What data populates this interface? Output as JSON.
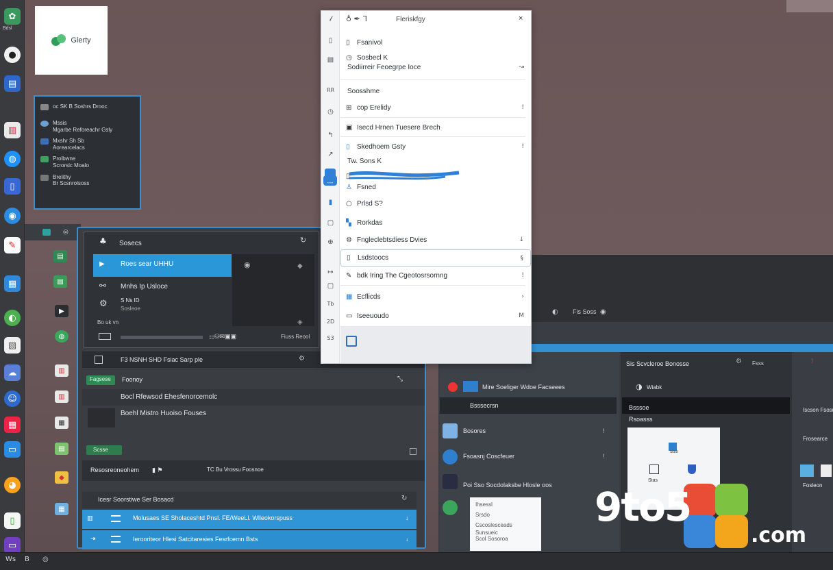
{
  "colors": {
    "accent": "#2f95d6",
    "menu_bg": "#ffffff",
    "dark_window": "#3a3d42"
  },
  "glerty": {
    "name": "Glerty"
  },
  "mini_panel": {
    "title": "oc SK B Soshrs Drooc",
    "rows": [
      {
        "icon": "user-icon",
        "line1": "Mssis",
        "line2": "Mgarbe Reforeachr Gsly"
      },
      {
        "icon": "book-icon",
        "line1": "Mxshr Sh Sb",
        "line2": "Aorearcelacs"
      },
      {
        "icon": "leaf-icon",
        "line1": "Prolbwne",
        "line2": "Scrorsic Moalo"
      },
      {
        "icon": "folder-icon",
        "line1": "Brelithy",
        "line2": "Br Scsnrolsoss"
      }
    ]
  },
  "context_menu": {
    "header": {
      "title": "Fleriskfgy",
      "close": "×"
    },
    "items": [
      {
        "icon": "doc-icon",
        "label": "Fsanivol",
        "right": ""
      },
      {
        "icon": "clock-icon",
        "label": "Sosbecl K",
        "right": ""
      },
      {
        "icon": "",
        "label": "Sodiirreir Feoegrpe Ioce",
        "right": "↝"
      },
      {
        "icon": "",
        "label": "Soosshme",
        "right": ""
      },
      {
        "icon": "grid-icon",
        "label": "cop Erelidy",
        "right": "!"
      },
      {
        "icon": "image-icon",
        "label": "Isecd Hrnen Tuesere Brech",
        "right": ""
      },
      {
        "icon": "file-icon",
        "label": "Skedhoem Gsty",
        "right": "!"
      },
      {
        "icon": "",
        "label": "Tw. Sons K",
        "right": ""
      },
      {
        "icon": "doc-icon",
        "label": "",
        "right": ""
      },
      {
        "icon": "person-icon",
        "label": "Fsned",
        "right": ""
      },
      {
        "icon": "circle-icon",
        "label": "Prlsd S?",
        "right": ""
      },
      {
        "icon": "chart-icon",
        "label": "Rorkdas",
        "right": ""
      },
      {
        "icon": "gear-icon",
        "label": "Fngleclebtsdiess Dvies",
        "right": "↓"
      },
      {
        "icon": "doc-icon",
        "label": "Lsdstoocs",
        "right": "§"
      },
      {
        "icon": "pen-icon",
        "label": "bdk Iring The Cgeotosrsornng",
        "right": "!"
      },
      {
        "icon": "table-icon",
        "label": "Ecflicds",
        "right": "›"
      },
      {
        "icon": "monitor-icon",
        "label": "Iseeuoudo",
        "right": "M"
      }
    ]
  },
  "main_window": {
    "title": "Sosecs",
    "highlight_label": "Roes sear UHHU",
    "row2": "Mnhs Ip Usloce",
    "row3a": "S Ns ID",
    "row3b": "Sosleoe",
    "row4": "Bo uk vn",
    "toolbar_right": "Fiuss Reool",
    "list_header": "F3 NSNH SHD Fsiac Sarp ple",
    "list_rows": [
      "Foonoy",
      "Bocl Rfewsod Ehesfenorcemolc",
      "Boehl Mistro Huoiso Fouses"
    ],
    "green_btn": "Scsse",
    "green_chip": "Fagsese",
    "status_line": "Resosreoneohem",
    "status_mid": "TC Bu Vrossu Foosnoe",
    "bottom_header": "Icesr Soorstiwe Ser Bosacd",
    "bottom_rows": [
      "Molusaes SE Sholaceshtd Pnsl. FE/WeeLl. Wlleokorspuss",
      "Ierooriteor Hlesi Satcitaresies Fesrfcemn Bsts"
    ]
  },
  "right_window": {
    "icons_top": "Fis Soss",
    "panel_a_title": "Mire Soeliger Wdoe Facseees",
    "panel_a_sub": "Bsssecrsn",
    "panel_a_rows": [
      "Bosores",
      "Fsoasnj Coscfeuer",
      "Poi Sso Socdolaksbe Hlosle oos"
    ],
    "panel_b_title": "Sis Scvcleroe Bonosse",
    "panel_b_sub": "Wiabk",
    "panel_b_header": "Bsssoe",
    "panel_b_row": "Rsoasss",
    "panel_c_rows": [
      "Iscson Fsosusmeca",
      "Frosearce",
      "Fosleon"
    ],
    "card_labels": [
      "Stas",
      "Sosl"
    ],
    "popover": [
      "Ihsessl",
      "Srsdo",
      "Cscoslesceads",
      "Sunsueic",
      "Scol Sosoroa"
    ]
  },
  "taskbar": {
    "left_label": "Ws",
    "right_label": "B"
  },
  "watermark": {
    "text": "9to5",
    "suffix": ".com"
  }
}
